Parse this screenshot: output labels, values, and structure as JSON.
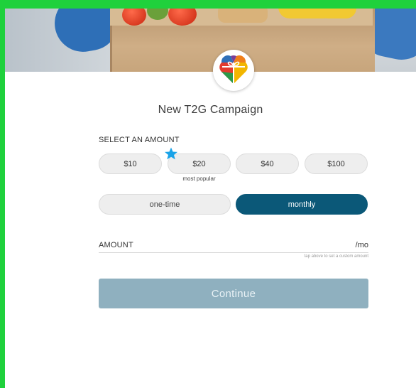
{
  "campaign": {
    "title": "New T2G Campaign"
  },
  "amounts": {
    "section_label": "SELECT AN AMOUNT",
    "options": [
      "$10",
      "$20",
      "$40",
      "$100"
    ],
    "popular_note": "most popular"
  },
  "frequency": {
    "one_time": "one-time",
    "monthly": "monthly",
    "selected": "monthly"
  },
  "custom_amount": {
    "label": "AMOUNT",
    "suffix": "/mo",
    "hint": "tap above to set a custom amount"
  },
  "actions": {
    "continue_label": "Continue"
  },
  "colors": {
    "frame_green": "#1fd13c",
    "primary": "#0b5878",
    "continue_disabled": "#8fb0bf",
    "star": "#1aa3e8"
  }
}
